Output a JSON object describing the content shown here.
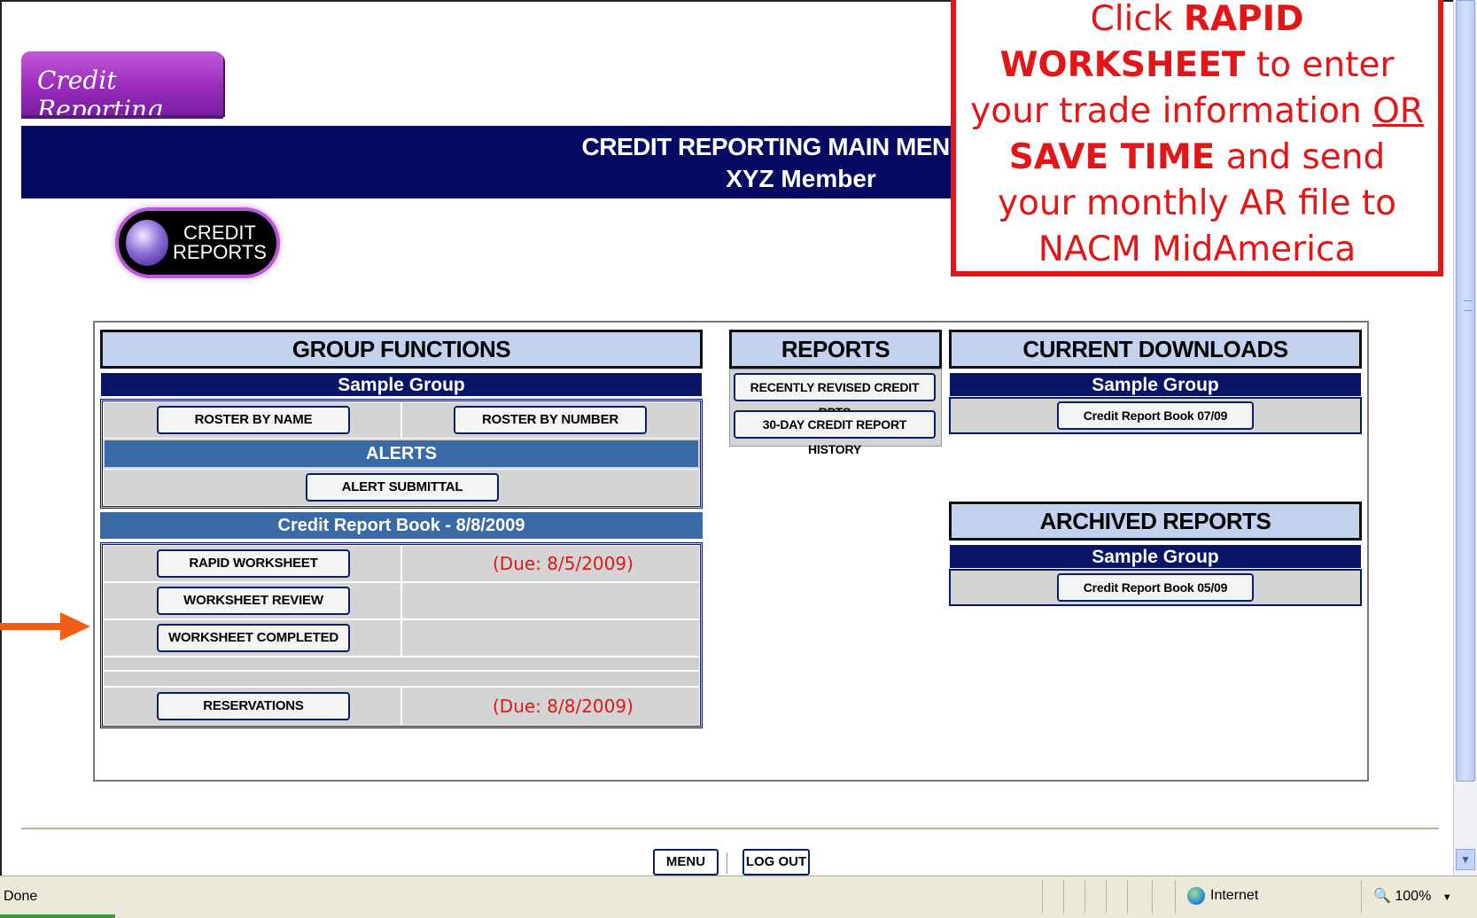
{
  "app": {
    "tab_logo": "Credit Reporting",
    "banner_title": "CREDIT REPORTING MAIN MENU",
    "banner_subtitle": "XYZ Member",
    "credit_reports_button": "CREDIT REPORTS"
  },
  "callout": {
    "line1_pre": "Click ",
    "line1_bold": "RAPID",
    "line2_bold": "WORKSHEET",
    "line2_post": " to enter",
    "line3_pre": "your trade information ",
    "line3_underline": "OR",
    "line4_bold": "SAVE TIME",
    "line4_post": " and send",
    "line5": "your monthly AR file to",
    "line6": "NACM MidAmerica",
    "color": "#e21616"
  },
  "group_functions": {
    "header": "GROUP FUNCTIONS",
    "group_name": "Sample Group",
    "roster_by_name": "ROSTER BY NAME",
    "roster_by_number": "ROSTER BY NUMBER",
    "alerts_header": "ALERTS",
    "alert_submittal": "ALERT SUBMITTAL",
    "book_header": "Credit Report Book  - 8/8/2009",
    "rapid_worksheet": "RAPID WORKSHEET",
    "rapid_due": "(Due: 8/5/2009)",
    "worksheet_review": "WORKSHEET REVIEW",
    "worksheet_completed": "WORKSHEET COMPLETED",
    "reservations": "RESERVATIONS",
    "reservations_due": "(Due: 8/8/2009)"
  },
  "reports": {
    "header": "REPORTS",
    "recently_revised": "RECENTLY REVISED CREDIT RPTS",
    "history": "30-DAY CREDIT REPORT HISTORY"
  },
  "current_downloads": {
    "header": "CURRENT DOWNLOADS",
    "group_name": "Sample Group",
    "book": "Credit Report Book 07/09"
  },
  "archived_reports": {
    "header": "ARCHIVED REPORTS",
    "group_name": "Sample Group",
    "book": "Credit Report Book 05/09"
  },
  "footer": {
    "menu": "MENU",
    "logout": "LOG OUT"
  },
  "statusbar": {
    "status_text": "Done",
    "zone": "Internet",
    "zoom": "100%"
  },
  "icons": {
    "arrow": "arrow-right-icon",
    "globe": "globe-icon",
    "zoom": "magnifier-icon"
  }
}
